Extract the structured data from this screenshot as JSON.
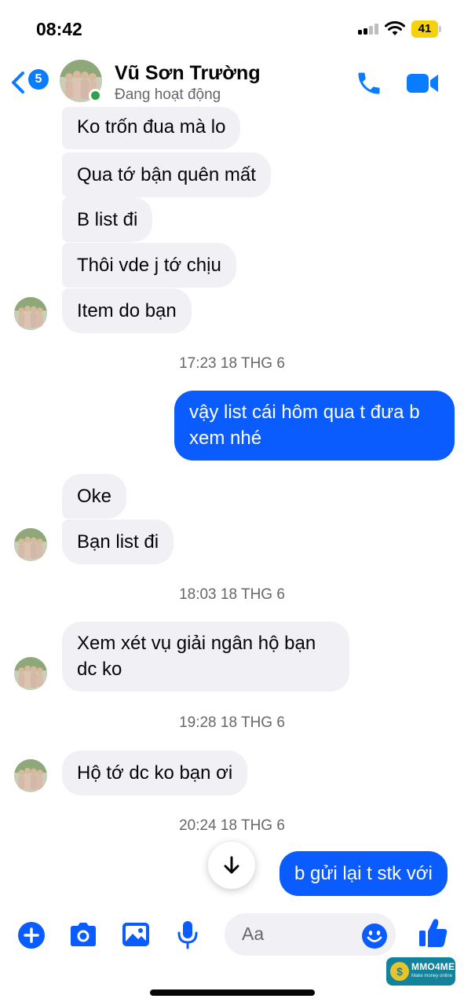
{
  "status_bar": {
    "time": "08:42",
    "battery_level": "41",
    "battery_color": "#f5d20b"
  },
  "header": {
    "back_badge_count": "5",
    "contact_name": "Vũ Sơn Trường",
    "contact_status": "Đang hoạt động",
    "accent_color": "#0a7cff",
    "icons": [
      "chevron-left-icon",
      "phone-icon",
      "video-camera-icon"
    ]
  },
  "messages": [
    {
      "sender": "contact",
      "text": "Ko trốn đua mà lo"
    },
    {
      "sender": "contact",
      "text": "Qua tớ bận quên mất"
    },
    {
      "sender": "contact",
      "text": "B list đi"
    },
    {
      "sender": "contact",
      "text": "Thôi vde j tớ chịu"
    },
    {
      "sender": "contact",
      "text": "Item do bạn"
    },
    {
      "type": "timestamp",
      "text": "17:23 18 THG 6"
    },
    {
      "sender": "me",
      "lines": [
        "vậy list cái hôm qua t đưa b",
        "xem nhé"
      ]
    },
    {
      "sender": "contact",
      "text": "Oke"
    },
    {
      "sender": "contact",
      "text": "Bạn list đi"
    },
    {
      "type": "timestamp",
      "text": "18:03 18 THG 6"
    },
    {
      "sender": "contact",
      "lines": [
        "Xem xét vụ giải ngân hộ bạn",
        "dc ko"
      ]
    },
    {
      "type": "timestamp",
      "text": "19:28 18 THG 6"
    },
    {
      "sender": "contact",
      "text": "Hộ tớ dc ko bạn ơi"
    },
    {
      "type": "timestamp",
      "text": "20:24 18 THG 6"
    },
    {
      "sender": "me",
      "text": "b gửi lại t stk với"
    }
  ],
  "composer": {
    "placeholder": "Aa",
    "icons": [
      "plus-icon",
      "camera-icon",
      "image-icon",
      "microphone-icon",
      "emoji-icon",
      "thumbs-up-icon"
    ]
  },
  "watermark": {
    "brand": "MMO4ME",
    "tagline": "Make money online"
  },
  "colors": {
    "outgoing_bubble": "#0a5cff",
    "incoming_bubble": "#f0f0f5",
    "composer_icons": "#0a5cff"
  }
}
